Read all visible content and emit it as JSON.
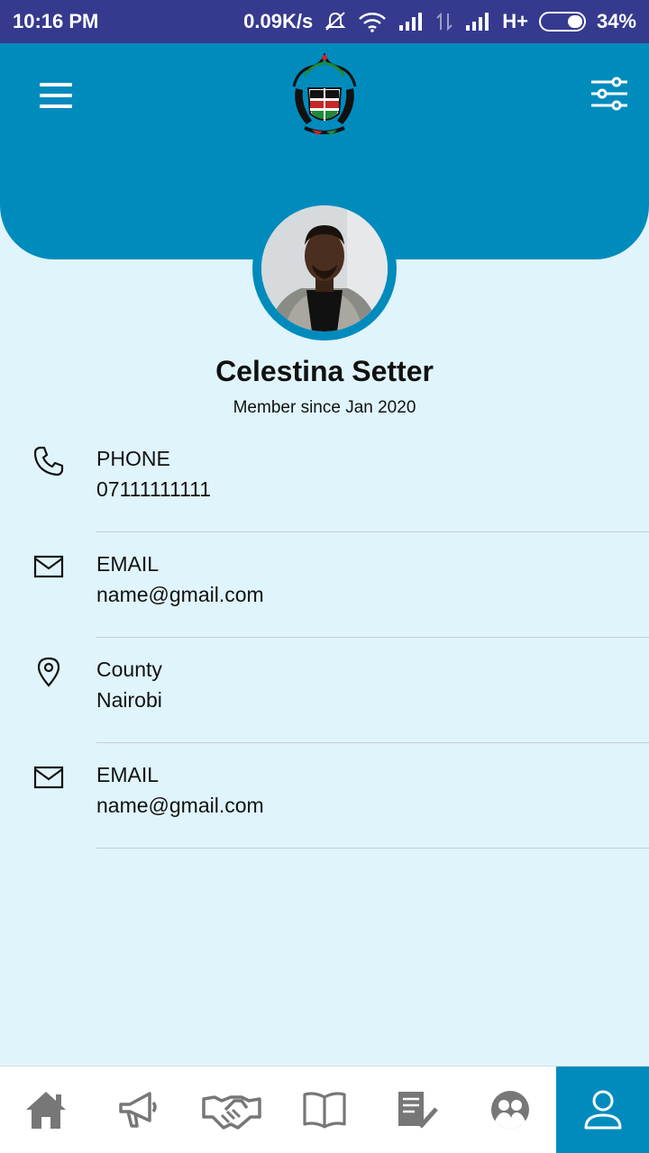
{
  "status_bar": {
    "time": "10:16 PM",
    "net_speed": "0.09K/s",
    "network_type": "H+",
    "battery": "34%"
  },
  "header": {
    "menu_icon": "hamburger-menu-icon",
    "logo_icon": "kenya-coat-of-arms-logo",
    "filter_icon": "sliders-filter-icon"
  },
  "profile": {
    "name": "Celestina Setter",
    "member_since": "Member since Jan 2020"
  },
  "info": [
    {
      "icon": "phone-icon",
      "label": "PHONE",
      "value": "07111111111"
    },
    {
      "icon": "mail-icon",
      "label": "EMAIL",
      "value": "name@gmail.com"
    },
    {
      "icon": "location-pin-icon",
      "label": "County",
      "value": "Nairobi"
    },
    {
      "icon": "mail-icon",
      "label": "EMAIL",
      "value": "name@gmail.com"
    }
  ],
  "bottom_nav": [
    {
      "icon": "home-icon",
      "active": false
    },
    {
      "icon": "megaphone-icon",
      "active": false
    },
    {
      "icon": "handshake-icon",
      "active": false
    },
    {
      "icon": "book-icon",
      "active": false
    },
    {
      "icon": "checklist-icon",
      "active": false
    },
    {
      "icon": "group-icon",
      "active": false
    },
    {
      "icon": "profile-icon",
      "active": true
    }
  ],
  "colors": {
    "status_bar": "#353a8e",
    "primary": "#008bbd",
    "background": "#e0f4fb",
    "nav_icon": "#777777"
  }
}
